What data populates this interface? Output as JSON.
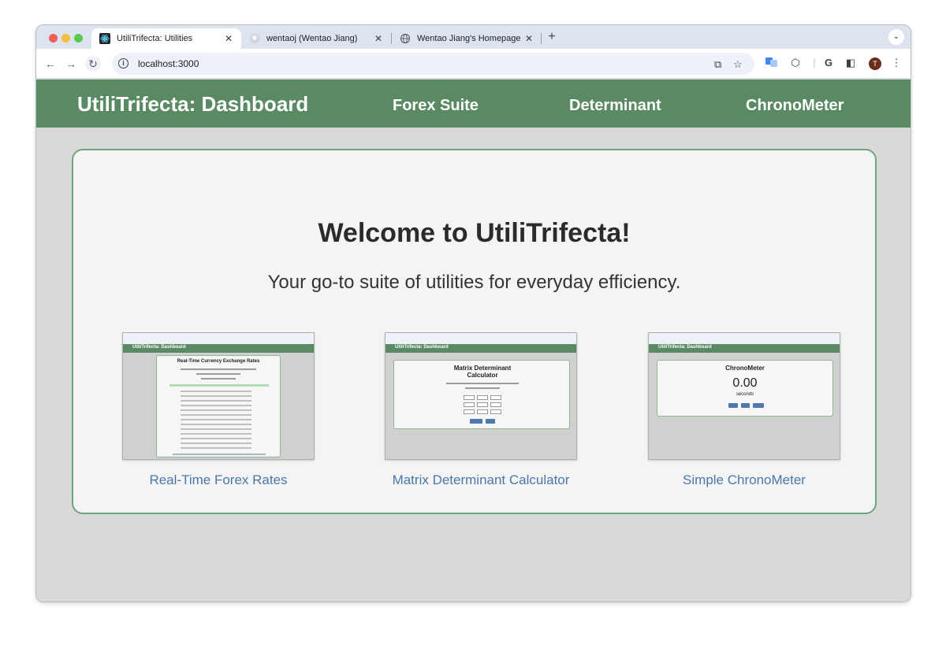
{
  "browser": {
    "tabs": [
      {
        "title": "UtiliTrifecta: Utilities",
        "close": "✕",
        "icon": "react-icon"
      },
      {
        "title": "wentaoj (Wentao Jiang)",
        "close": "✕",
        "icon": "github-icon"
      },
      {
        "title": "Wentao Jiang's Homepage",
        "close": "✕",
        "icon": "globe-icon"
      }
    ],
    "new_tab": "+",
    "tab_menu": "⌄",
    "url": "localhost:3000",
    "avatar_initial": "T"
  },
  "app": {
    "brand": "UtiliTrifecta: Dashboard",
    "nav": [
      "Forex Suite",
      "Determinant",
      "ChronoMeter"
    ],
    "nav_color": "#5a8a64"
  },
  "welcome": {
    "title": "Welcome to UtiliTrifecta!",
    "tagline": "Your go-to suite of utilities for everyday efficiency."
  },
  "tiles": [
    {
      "label": "Real-Time Forex Rates",
      "thumb_title": "Real-Time Currency Exchange Rates"
    },
    {
      "label": "Matrix Determinant Calculator",
      "thumb_title": "Matrix Determinant Calculator"
    },
    {
      "label": "Simple ChronoMeter",
      "thumb_title": "ChronoMeter",
      "thumb_value": "0.00",
      "thumb_unit": "seconds"
    }
  ],
  "thumb_brand": "UtiliTrifecta: Dashboard"
}
